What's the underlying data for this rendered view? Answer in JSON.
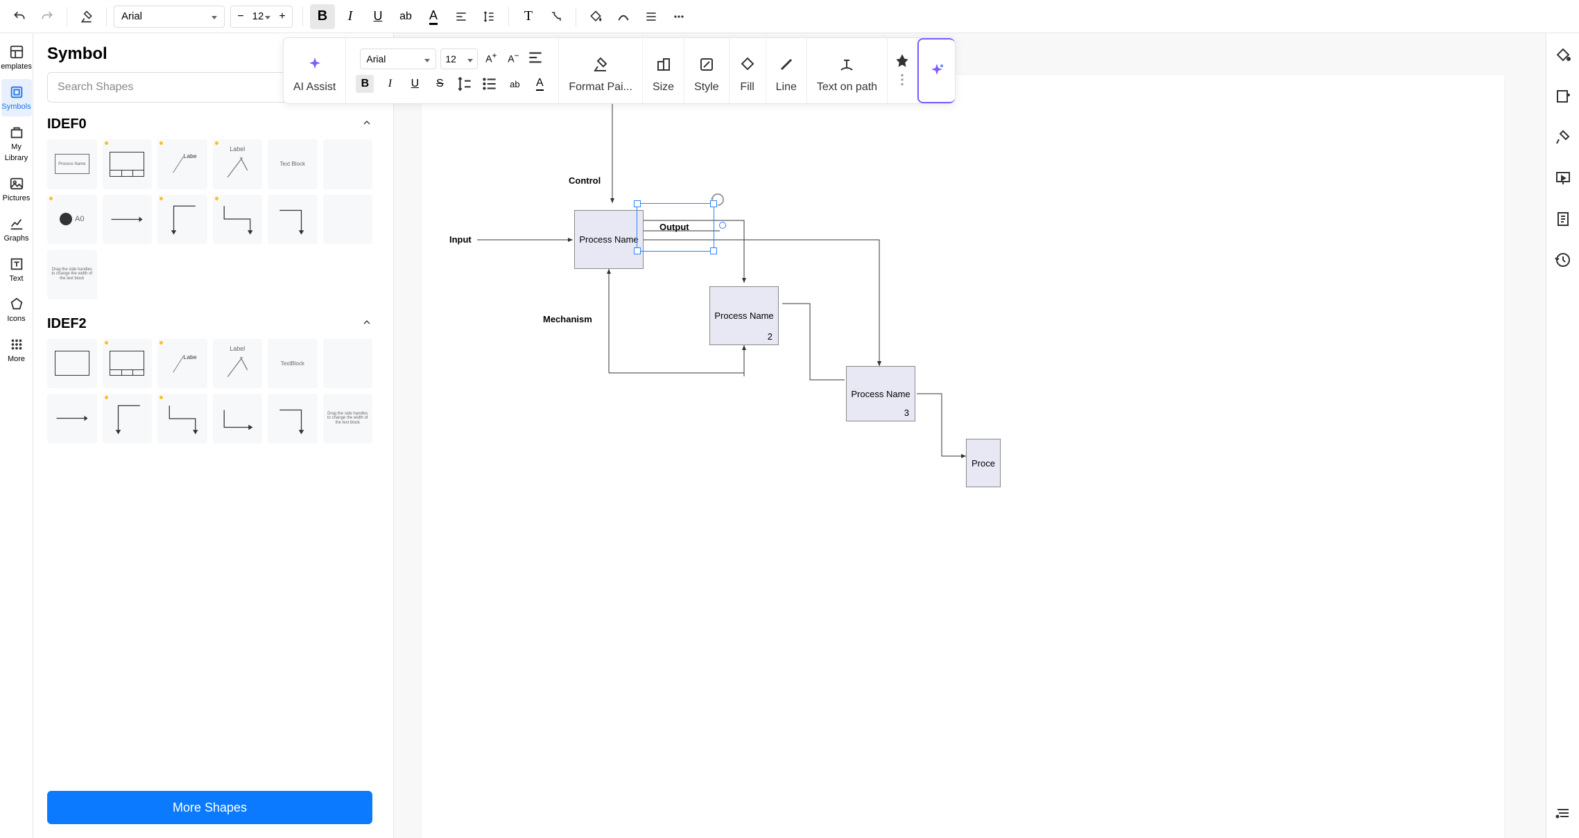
{
  "toolbar": {
    "font": "Arial",
    "fontSize": "12"
  },
  "miniSidebar": {
    "templates": "emplates",
    "symbols": "Symbols",
    "myLibrary1": "My",
    "myLibrary2": "Library",
    "pictures": "Pictures",
    "graphs": "Graphs",
    "text": "Text",
    "icons": "Icons",
    "more": "More"
  },
  "panel": {
    "title": "Symbol",
    "searchPlaceholder": "Search Shapes",
    "cat1": "IDEF0",
    "cat2": "IDEF2",
    "moreShapes": "More Shapes",
    "shapes1": {
      "s0": "Process Name",
      "s2": "Label",
      "s3": "Label",
      "s4": "Text Block",
      "s5": "A0",
      "s12": "Drag the side handles to change the width of the text block"
    },
    "shapes2": {
      "s2": "Label",
      "s3": "Label",
      "s4": "TextBlock",
      "s11": "Drag the side handles to change the width of the text block"
    }
  },
  "floatToolbar": {
    "aiAssist": "AI Assist",
    "font": "Arial",
    "size": "12",
    "formatPainter": "Format Pai...",
    "sizeLabel": "Size",
    "style": "Style",
    "fill": "Fill",
    "line": "Line",
    "textOnPath": "Text on path"
  },
  "diagram": {
    "control": "Control",
    "input": "Input",
    "output": "Output",
    "mechanism": "Mechanism",
    "box1": "Process Name",
    "box2": "Process Name",
    "box2num": "2",
    "box3": "Process Name",
    "box3num": "3",
    "box4": "Proce"
  }
}
